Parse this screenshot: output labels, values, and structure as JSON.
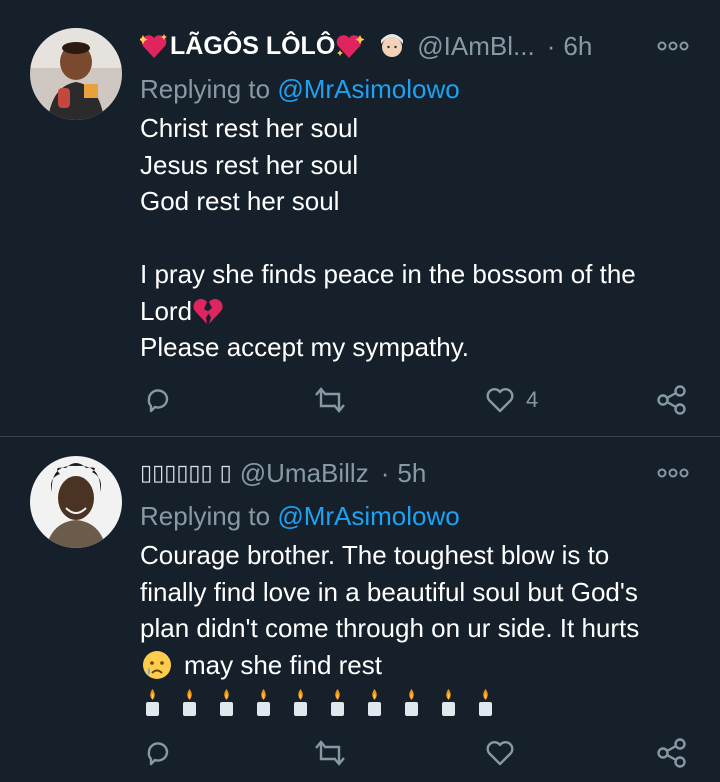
{
  "tweets": [
    {
      "display_name": "LÃGÔS LÔLÔ",
      "handle": "@IAmBl...",
      "separator": "·",
      "time": "6h",
      "reply_prefix": "Replying to",
      "reply_to": "@MrAsimolowo",
      "lines": [
        "Christ rest her soul",
        "Jesus rest her soul",
        "God rest her soul",
        "",
        "I pray she finds peace in the bossom of the",
        "Lord",
        "Please accept my sympathy."
      ],
      "like_count": "4",
      "icons": [
        "sparkling-heart-icon",
        "bride-icon",
        "broken-heart-icon"
      ]
    },
    {
      "display_name": "🅄🄼🄰🄱🄸🄻🄻🅉 🄰",
      "display_name_boxes": "▯▯▯▯▯▯ ▯",
      "handle": "@UmaBillz",
      "separator": "·",
      "time": "5h",
      "reply_prefix": "Replying to",
      "reply_to": "@MrAsimolowo",
      "lines": [
        "Courage brother. The toughest blow is to",
        "finally find love in a beautiful soul but God's",
        "plan didn't come through on ur side. It hurts",
        "may she find rest"
      ],
      "like_count": "",
      "icons": [
        "crying-face-icon",
        "candle-icon"
      ]
    }
  ],
  "colors": {
    "background": "#15202b",
    "text": "#ffffff",
    "muted": "#8899a6",
    "link": "#1da1f2",
    "divider": "#38444d"
  }
}
